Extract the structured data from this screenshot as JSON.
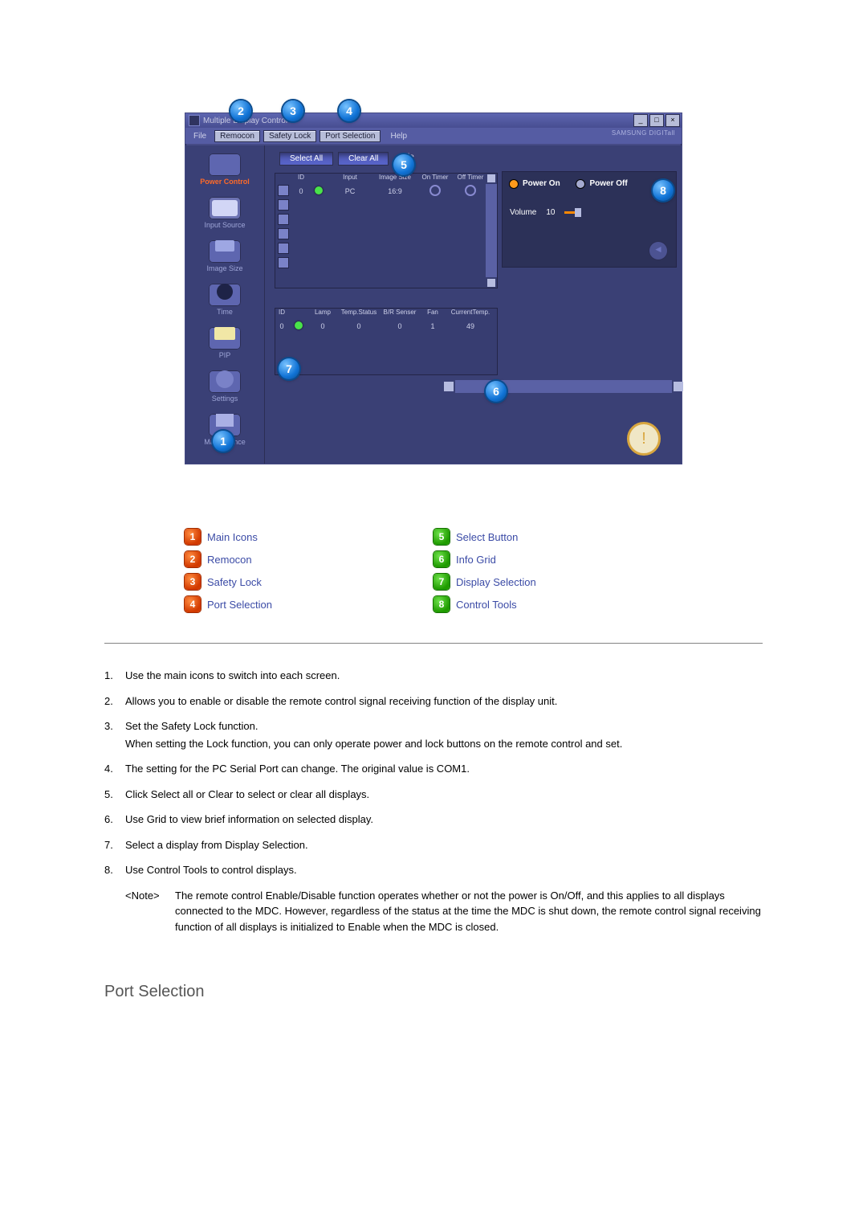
{
  "window": {
    "title": "Multiple Display Control",
    "brand": "SAMSUNG DIGITall",
    "win_min": "_",
    "win_max": "□",
    "win_close": "×",
    "menu": {
      "file": "File",
      "remocon": "Remocon",
      "safety_lock": "Safety Lock",
      "port_selection": "Port Selection",
      "help": "Help"
    },
    "sidebar": [
      {
        "label": "Power Control",
        "active": true
      },
      {
        "label": "Input Source"
      },
      {
        "label": "Image Size"
      },
      {
        "label": "Time"
      },
      {
        "label": "PIP"
      },
      {
        "label": "Settings"
      },
      {
        "label": "Maintenance"
      }
    ],
    "buttons": {
      "select_all": "Select All",
      "clear_all": "Clear All"
    },
    "enable_suffix": "le",
    "grid1": {
      "headers": [
        "",
        "ID",
        "",
        "Input",
        "Image Size",
        "On Timer",
        "Off Timer"
      ],
      "row": {
        "id": "0",
        "input": "PC",
        "image": "16:9"
      }
    },
    "grid2": {
      "headers": [
        "ID",
        "",
        "Lamp",
        "Temp.Status",
        "B/R Senser",
        "Fan",
        "CurrentTemp."
      ],
      "row": {
        "id": "0",
        "lamp": "0",
        "temp": "0",
        "br": "0",
        "fan": "1",
        "ct": "49"
      }
    },
    "control": {
      "power_on": "Power On",
      "power_off": "Power Off",
      "volume_label": "Volume",
      "volume_value": "10"
    },
    "warn": "!"
  },
  "callouts": {
    "1": "1",
    "2": "2",
    "3": "3",
    "4": "4",
    "5": "5",
    "6": "6",
    "7": "7",
    "8": "8"
  },
  "legend": {
    "left": [
      {
        "n": "1",
        "t": "Main Icons"
      },
      {
        "n": "2",
        "t": "Remocon"
      },
      {
        "n": "3",
        "t": "Safety Lock"
      },
      {
        "n": "4",
        "t": "Port Selection"
      }
    ],
    "right": [
      {
        "n": "5",
        "t": "Select Button"
      },
      {
        "n": "6",
        "t": "Info Grid"
      },
      {
        "n": "7",
        "t": "Display Selection"
      },
      {
        "n": "8",
        "t": "Control Tools"
      }
    ]
  },
  "doc": {
    "li1": "Use the main icons to switch into each screen.",
    "li2": "Allows you to enable or disable the remote control signal receiving function of the display unit.",
    "li3a": "Set the Safety Lock function.",
    "li3b": "When setting the Lock function, you can only operate power and lock buttons on the remote control and set.",
    "li4": "The setting for the PC Serial Port can change. The original value is COM1.",
    "li5": "Click Select all or Clear to select or clear all displays.",
    "li6": "Use Grid to view brief information on selected display.",
    "li7": "Select a display from Display Selection.",
    "li8": "Use Control Tools to control displays.",
    "note_label": "<Note>",
    "note_body": "The remote control Enable/Disable function operates whether or not the power is On/Off, and this applies to all displays connected to the MDC. However, regardless of the status at the time the MDC is shut down, the remote control signal receiving function of all displays is initialized to Enable when the MDC is closed."
  },
  "section_heading": "Port Selection"
}
